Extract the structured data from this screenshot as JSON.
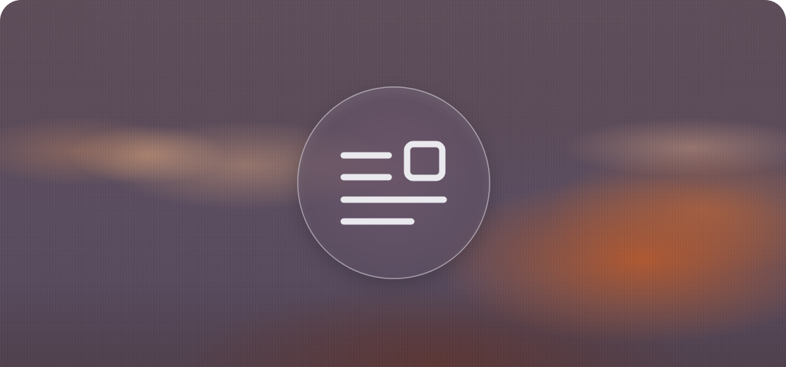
{
  "badge": {
    "icon": "article-icon",
    "icon_color": "#e9e9ee"
  }
}
